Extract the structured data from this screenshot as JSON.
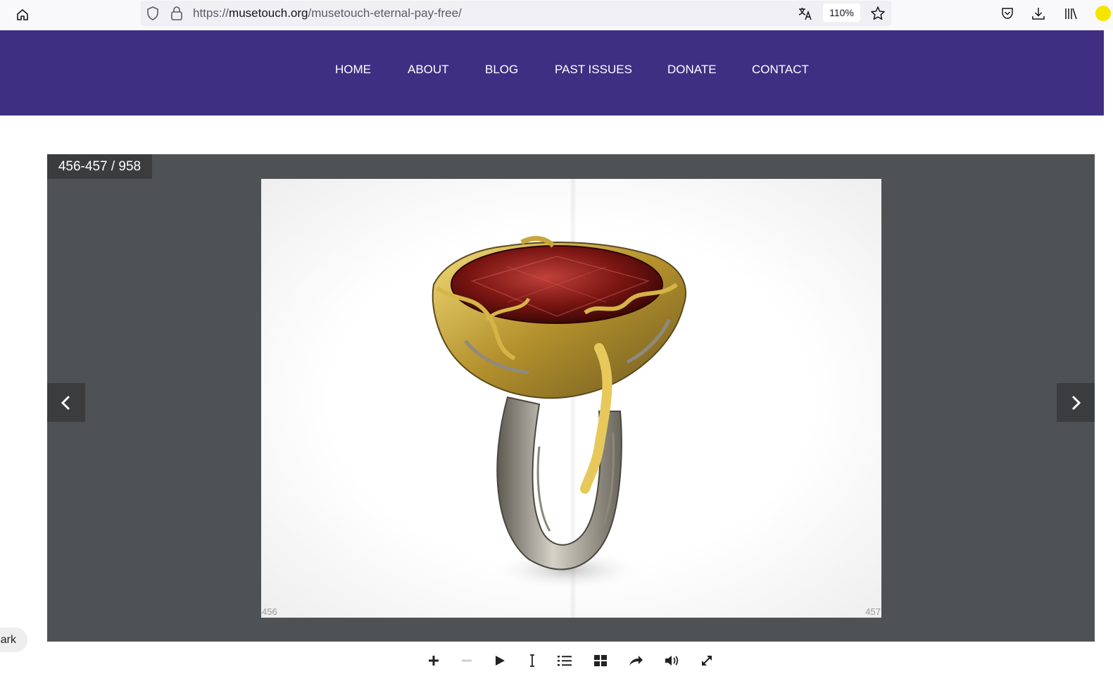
{
  "browser": {
    "url_scheme": "https://",
    "url_domain": "musetouch.org",
    "url_path": "/musetouch-eternal-pay-free/",
    "zoom": "110%"
  },
  "nav": {
    "items": [
      {
        "label": "HOME"
      },
      {
        "label": "ABOUT"
      },
      {
        "label": "BLOG"
      },
      {
        "label": "PAST ISSUES"
      },
      {
        "label": "DONATE"
      },
      {
        "label": "CONTACT"
      }
    ]
  },
  "viewer": {
    "page_counter": "456-457 / 958",
    "left_page_number": "456",
    "right_page_number": "457"
  },
  "toolbar": {
    "tools": [
      "zoom-in-icon",
      "zoom-out-icon",
      "play-icon",
      "text-select-icon",
      "table-of-contents-icon",
      "thumbnails-icon",
      "share-icon",
      "sound-icon",
      "fullscreen-icon"
    ]
  },
  "dark_mode": {
    "label": "ark"
  },
  "colors": {
    "header": "#3f2f83",
    "viewer_bg": "#4f5254",
    "viewer_dark": "#3a3c3e"
  }
}
